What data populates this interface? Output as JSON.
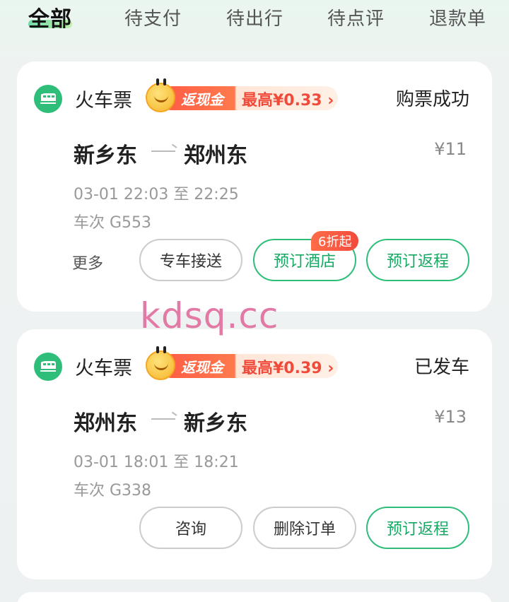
{
  "tabs": [
    {
      "label": "全部",
      "active": true
    },
    {
      "label": "待支付",
      "active": false
    },
    {
      "label": "待出行",
      "active": false
    },
    {
      "label": "待点评",
      "active": false
    },
    {
      "label": "退款单",
      "active": false
    }
  ],
  "orders": [
    {
      "type": "火车票",
      "cashback_label": "返现金",
      "cashback_amount": "最高¥0.33",
      "cashback_arrow": "›",
      "status": "购票成功",
      "from": "新乡东",
      "to": "郑州东",
      "price": "¥11",
      "time": "03-01 22:03 至 22:25",
      "train": "车次 G553",
      "more": "更多",
      "buttons": [
        "专车接送",
        "预订酒店",
        "预订返程"
      ],
      "hotel_badge": "6折起"
    },
    {
      "type": "火车票",
      "cashback_label": "返现金",
      "cashback_amount": "最高¥0.39",
      "cashback_arrow": "›",
      "status": "已发车",
      "from": "郑州东",
      "to": "新乡东",
      "price": "¥13",
      "time": "03-01 18:01 至 18:21",
      "train": "车次 G338",
      "buttons": [
        "咨询",
        "删除订单",
        "预订返程"
      ]
    }
  ],
  "watermark": "kdsq.cc",
  "colors": {
    "accent_green": "#2fbd7a",
    "cashback_red": "#f04a3a"
  }
}
